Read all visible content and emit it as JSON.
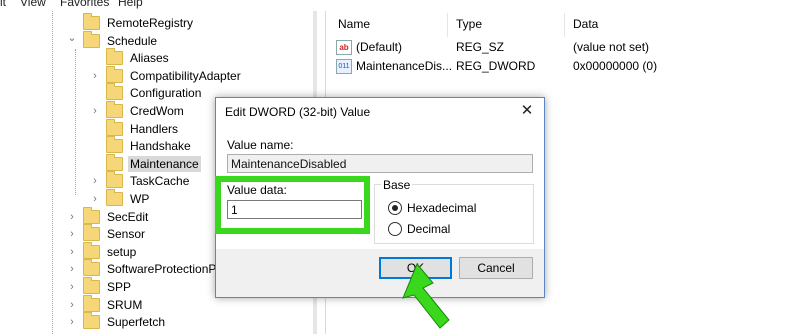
{
  "menubar": [
    "it",
    "View",
    "Favorites",
    "Help"
  ],
  "tree": {
    "items": [
      {
        "label": "RemoteRegistry",
        "expander": "",
        "level": 0,
        "selected": false
      },
      {
        "label": "Schedule",
        "expander": "v",
        "level": 0,
        "selected": false
      },
      {
        "label": "Aliases",
        "expander": "",
        "level": 1,
        "selected": false
      },
      {
        "label": "CompatibilityAdapter",
        "expander": ">",
        "level": 1,
        "selected": false
      },
      {
        "label": "Configuration",
        "expander": "",
        "level": 1,
        "selected": false
      },
      {
        "label": "CredWom",
        "expander": ">",
        "level": 1,
        "selected": false
      },
      {
        "label": "Handlers",
        "expander": "",
        "level": 1,
        "selected": false
      },
      {
        "label": "Handshake",
        "expander": "",
        "level": 1,
        "selected": false
      },
      {
        "label": "Maintenance",
        "expander": "",
        "level": 1,
        "selected": true
      },
      {
        "label": "TaskCache",
        "expander": ">",
        "level": 1,
        "selected": false
      },
      {
        "label": "WP",
        "expander": ">",
        "level": 1,
        "selected": false
      },
      {
        "label": "SecEdit",
        "expander": ">",
        "level": 0,
        "selected": false
      },
      {
        "label": "Sensor",
        "expander": ">",
        "level": 0,
        "selected": false
      },
      {
        "label": "setup",
        "expander": ">",
        "level": 0,
        "selected": false
      },
      {
        "label": "SoftwareProtectionPla",
        "expander": ">",
        "level": 0,
        "selected": false
      },
      {
        "label": "SPP",
        "expander": ">",
        "level": 0,
        "selected": false
      },
      {
        "label": "SRUM",
        "expander": ">",
        "level": 0,
        "selected": false
      },
      {
        "label": "Superfetch",
        "expander": ">",
        "level": 0,
        "selected": false
      }
    ]
  },
  "list": {
    "columns": {
      "name": "Name",
      "type": "Type",
      "data": "Data"
    },
    "rows": [
      {
        "icon": "string-value-icon",
        "icon_text": "ab",
        "name": "(Default)",
        "type": "REG_SZ",
        "data": "(value not set)"
      },
      {
        "icon": "binary-value-icon",
        "icon_text": "011",
        "name": "MaintenanceDis...",
        "type": "REG_DWORD",
        "data": "0x00000000 (0)"
      }
    ]
  },
  "dialog": {
    "title": "Edit DWORD (32-bit) Value",
    "close_glyph": "✕",
    "value_name_label": "Value name:",
    "value_name": "MaintenanceDisabled",
    "value_data_label": "Value data:",
    "value_data": "1",
    "base_label": "Base",
    "base_options": [
      {
        "label": "Hexadecimal",
        "checked": true
      },
      {
        "label": "Decimal",
        "checked": false
      }
    ],
    "ok_label": "OK",
    "cancel_label": "Cancel"
  },
  "annotation": {
    "highlight_color": "#39d81c",
    "arrow_color": "#39d81c"
  }
}
